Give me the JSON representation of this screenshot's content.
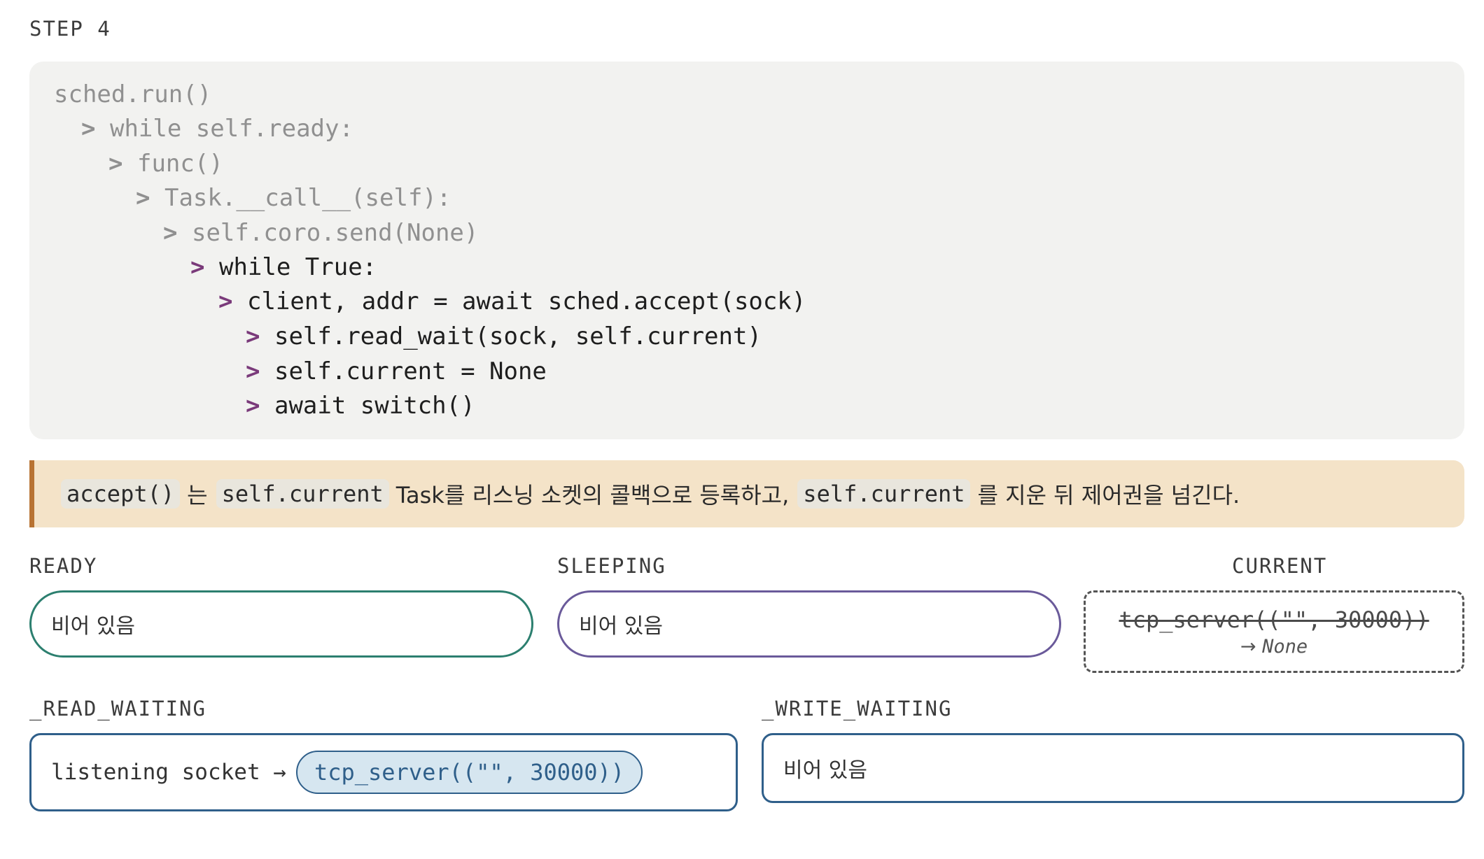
{
  "step_label": "STEP 4",
  "code_lines": [
    {
      "arrow": "",
      "text": "sched.run()"
    },
    {
      "arrow": ">",
      "text": "while self.ready:"
    },
    {
      "arrow": ">",
      "text": "func()"
    },
    {
      "arrow": ">",
      "text": "Task.__call__(self):"
    },
    {
      "arrow": ">",
      "text": "self.coro.send(None)"
    },
    {
      "arrow": ">",
      "text": "while True:"
    },
    {
      "arrow": ">",
      "text": "client, addr = await sched.accept(sock)"
    },
    {
      "arrow": ">",
      "text": "self.read_wait(sock, self.current)"
    },
    {
      "arrow": ">",
      "text": "self.current = None"
    },
    {
      "arrow": ">",
      "text": "await switch()"
    }
  ],
  "note": {
    "chip1": "accept()",
    "text1": "는",
    "chip2": "self.current",
    "text2": "Task를 리스닝 소켓의 콜백으로 등록하고,",
    "chip3": "self.current",
    "text3": "를 지운 뒤 제어권을 넘긴다."
  },
  "ready": {
    "label": "READY",
    "value": "비어 있음"
  },
  "sleeping": {
    "label": "SLEEPING",
    "value": "비어 있음"
  },
  "current": {
    "label": "CURRENT",
    "old_value": "tcp_server((\"\", 30000))",
    "new_prefix": "→",
    "new_value": "None"
  },
  "read_waiting": {
    "label": "_READ_WAITING",
    "entry_key": "listening socket →",
    "entry_task": "tcp_server((\"\", 30000))"
  },
  "write_waiting": {
    "label": "_WRITE_WAITING",
    "value": "비어 있음"
  },
  "colors": {
    "ready": "#2c7f6f",
    "sleeping": "#6a5a9a",
    "waiting": "#2f5f8a",
    "note_bg": "#f4e3c8",
    "note_bar": "#b87333",
    "arrow": "#7a3a7a"
  }
}
